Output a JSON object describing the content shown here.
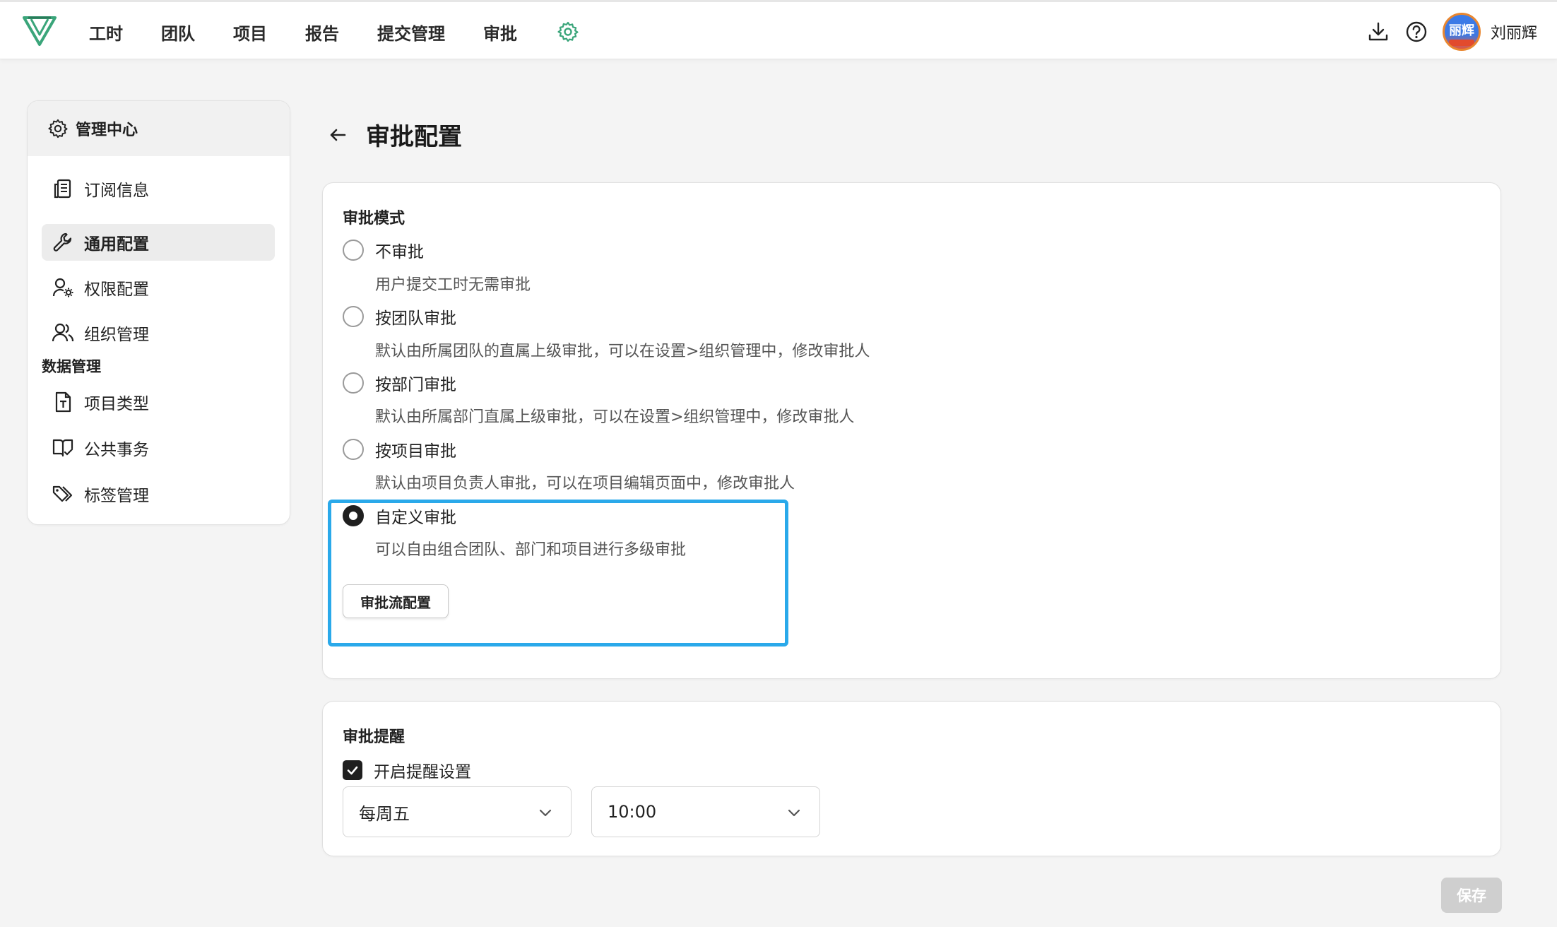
{
  "nav": {
    "logo_icon": "v-logo-icon",
    "items": [
      "工时",
      "团队",
      "项目",
      "报告",
      "提交管理",
      "审批"
    ],
    "settings_icon": "gear-icon",
    "accent_color": "#3aa57a"
  },
  "header_right": {
    "download_icon": "download-icon",
    "help_icon": "help-icon",
    "avatar_text": "丽辉",
    "user_name": "刘丽辉"
  },
  "sidebar": {
    "title": "管理中心",
    "items": [
      {
        "label": "订阅信息",
        "icon": "subscription-icon"
      },
      {
        "label": "通用配置",
        "icon": "wrench-icon",
        "active": true
      },
      {
        "label": "权限配置",
        "icon": "user-gear-icon"
      },
      {
        "label": "组织管理",
        "icon": "users-icon"
      }
    ],
    "group_label": "数据管理",
    "data_items": [
      {
        "label": "项目类型",
        "icon": "file-type-icon"
      },
      {
        "label": "公共事务",
        "icon": "book-check-icon"
      },
      {
        "label": "标签管理",
        "icon": "tags-icon"
      }
    ]
  },
  "page": {
    "title": "审批配置",
    "back_icon": "arrow-left-icon"
  },
  "approval_mode": {
    "label": "审批模式",
    "options": [
      {
        "label": "不审批",
        "desc": "用户提交工时无需审批",
        "checked": false
      },
      {
        "label": "按团队审批",
        "desc": "默认由所属团队的直属上级审批，可以在设置>组织管理中，修改审批人",
        "checked": false
      },
      {
        "label": "按部门审批",
        "desc": "默认由所属部门直属上级审批，可以在设置>组织管理中，修改审批人",
        "checked": false
      },
      {
        "label": "按项目审批",
        "desc": "默认由项目负责人审批，可以在项目编辑页面中，修改审批人",
        "checked": false
      },
      {
        "label": "自定义审批",
        "desc": "可以自由组合团队、部门和项目进行多级审批",
        "checked": true
      }
    ],
    "flow_button": "审批流配置",
    "highlight_color": "#2aa9ea"
  },
  "approval_reminder": {
    "label": "审批提醒",
    "checkbox_label": "开启提醒设置",
    "checked": true,
    "day_select": "每周五",
    "time_select": "10:00"
  },
  "save_button": "保存"
}
